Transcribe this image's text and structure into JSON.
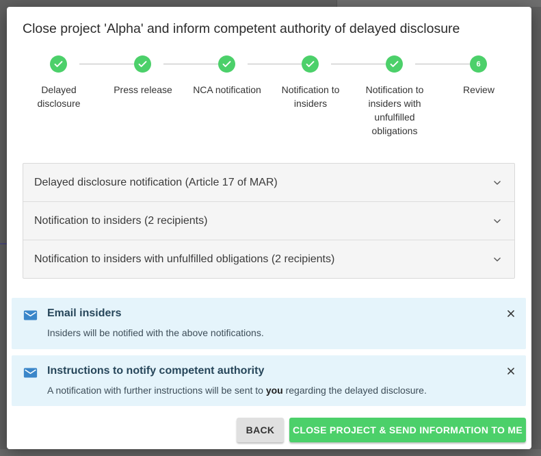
{
  "colors": {
    "success": "#4cd06a",
    "info_bg": "#e5f4fb",
    "info_icon": "#3a86c9"
  },
  "modal": {
    "title": "Close project 'Alpha' and inform competent authority of delayed disclosure"
  },
  "stepper": {
    "steps": [
      {
        "label": "Delayed disclosure",
        "status": "complete",
        "icon": "check-icon"
      },
      {
        "label": "Press release",
        "status": "complete",
        "icon": "check-icon"
      },
      {
        "label": "NCA notification",
        "status": "complete",
        "icon": "check-icon"
      },
      {
        "label": "Notification to insiders",
        "status": "complete",
        "icon": "check-icon"
      },
      {
        "label": "Notification to insiders with unfulfilled obligations",
        "status": "complete",
        "icon": "check-icon"
      },
      {
        "label": "Review",
        "status": "active",
        "number": "6"
      }
    ]
  },
  "accordion": {
    "items": [
      {
        "label": "Delayed disclosure notification (Article 17 of MAR)",
        "icon": "chevron-down-icon"
      },
      {
        "label": "Notification to insiders (2 recipients)",
        "icon": "chevron-down-icon"
      },
      {
        "label": "Notification to insiders with unfulfilled obligations (2 recipients)",
        "icon": "chevron-down-icon"
      }
    ]
  },
  "alerts": [
    {
      "title": "Email insiders",
      "body": "Insiders will be notified with the above notifications.",
      "icon": "mail-icon"
    },
    {
      "title": "Instructions to notify competent authority",
      "body_before": "A notification with further instructions will be sent to ",
      "body_bold": "you",
      "body_after": " regarding the delayed disclosure.",
      "icon": "mail-icon"
    }
  ],
  "actions": {
    "back_label": "BACK",
    "primary_label": "CLOSE PROJECT & SEND INFORMATION TO ME"
  }
}
